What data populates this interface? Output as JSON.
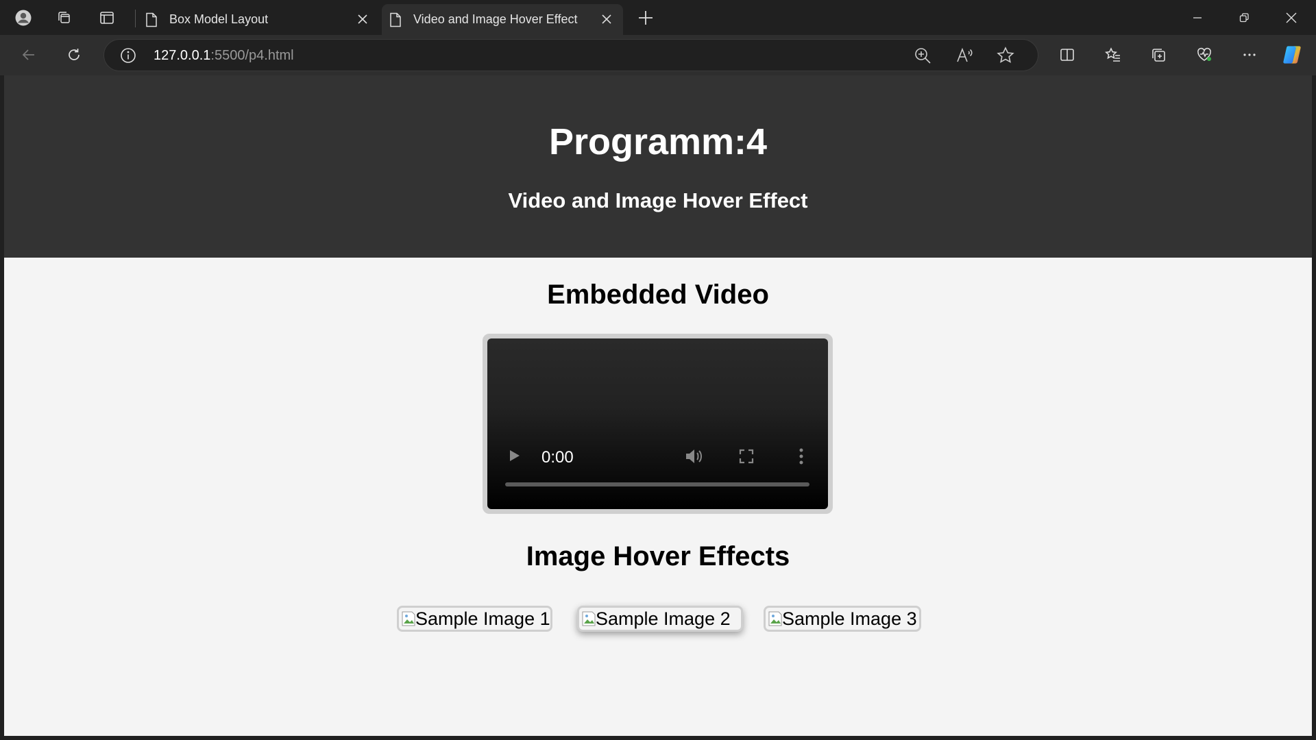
{
  "browser": {
    "tabs": [
      {
        "title": "Box Model Layout",
        "active": false
      },
      {
        "title": "Video and Image Hover Effect",
        "active": true
      }
    ],
    "address": {
      "host": "127.0.0.1",
      "rest": ":5500/p4.html"
    }
  },
  "page": {
    "title": "Programm:4",
    "subtitle": "Video and Image Hover Effect",
    "video_section_title": "Embedded Video",
    "video": {
      "time": "0:00",
      "progress": 0
    },
    "images_section_title": "Image Hover Effects",
    "images": [
      {
        "alt": "Sample Image 1",
        "hovered": false
      },
      {
        "alt": "Sample Image 2",
        "hovered": true
      },
      {
        "alt": "Sample Image 3",
        "hovered": false
      }
    ]
  },
  "colors": {
    "chrome_bg": "#202020",
    "toolbar_bg": "#2e2e2e",
    "header_bg": "#333333",
    "page_bg": "#f4f4f4",
    "border": "#cfcfcf"
  },
  "icons": [
    "profile-icon",
    "workspaces-icon",
    "tab-actions-icon",
    "document-icon",
    "close-icon",
    "new-tab-icon",
    "minimize-icon",
    "restore-icon",
    "back-icon",
    "refresh-icon",
    "info-icon",
    "zoom-icon",
    "read-aloud-icon",
    "favorite-star-icon",
    "split-screen-icon",
    "favorites-icon",
    "collections-icon",
    "browser-essentials-icon",
    "more-icon",
    "copilot-icon",
    "play-icon",
    "volume-icon",
    "fullscreen-icon",
    "broken-image-icon"
  ]
}
